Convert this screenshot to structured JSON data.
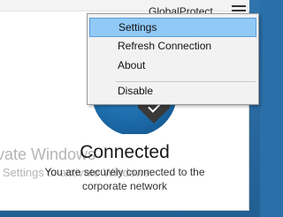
{
  "window": {
    "title": "GlobalProtect"
  },
  "status": {
    "title": "Connected",
    "subtitle_line1": "You are securely connected to the",
    "subtitle_line2": "corporate network"
  },
  "watermark": {
    "line1": "ivate Windows",
    "line2": "o Settings to activate Windows."
  },
  "context_menu": {
    "items": [
      {
        "label": "Settings"
      },
      {
        "label": "Refresh Connection"
      },
      {
        "label": "About"
      },
      {
        "label": "Disable"
      }
    ],
    "highlighted": "Settings"
  },
  "colors": {
    "highlight": "#91c9f7",
    "desktop": "#2a6fa8"
  }
}
